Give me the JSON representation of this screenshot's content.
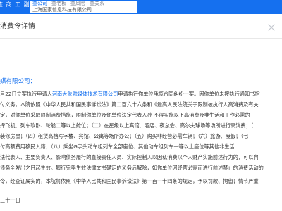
{
  "header": {
    "brand": "查 商 工 副",
    "search_tabs": [
      "查公司",
      "查老板",
      "查风险",
      "查关系"
    ],
    "search_value": "上海国家信息科技有限公司"
  },
  "dialog": {
    "title": "消费令详情",
    "close_icon": "close-icon"
  },
  "document": {
    "recipient": "媒有限公司：",
    "line1_before": "月22日立案执行申请人",
    "line1_link": "河南大象融媒体技术有限公司",
    "line1_after": "申请执行你单位承揽合同纠纷一案。因你单位未按执行通知书指",
    "line2": "付义务，本院依照《中华人民共和国民事诉讼法》第二百六十六条和《最高人民法院关于限制被执行人高消费及有关",
    "line3": "定，对你单位采取限制消费措施，限制你单位及你单位法定代表人孙        不得实施以下高消费及非生活和工作必需的",
    "line4": "择飞机、列车软卧、轮船二等以上舱位；（二）在星级以上宾馆、酒店、夜总会、高尔夫球场等场所进行高消费；（",
    "line5": "装修房屋；（四）租赁高档写字楼、宾馆、公寓等场所办公；（五）购买非经营必需车辆；（六）旅游、度假；（七",
    "line6": "付高额费用移民入籍，（八）乘坐G字头动车组列车全部座位、其他动车组列车一等以上座位等其他非生活",
    "line7": "法代表人、主要负责人、影响债务履行的直接责任人员、实际控制人以因私消费以个人财产实施前述行为的，可以向",
    "line8": "债务全发出之日起生效。履行完毕生效法律文书确定的义务后解除，如你单位因经营必需而进行前述禁止的消费活动的",
    "conclusion": "令，经查证属实的，本院将依照《中华人民共和国民事诉讼法》第一百一十四条的规定，予以罚款、拘留；情节严重",
    "date": "三十一日"
  }
}
